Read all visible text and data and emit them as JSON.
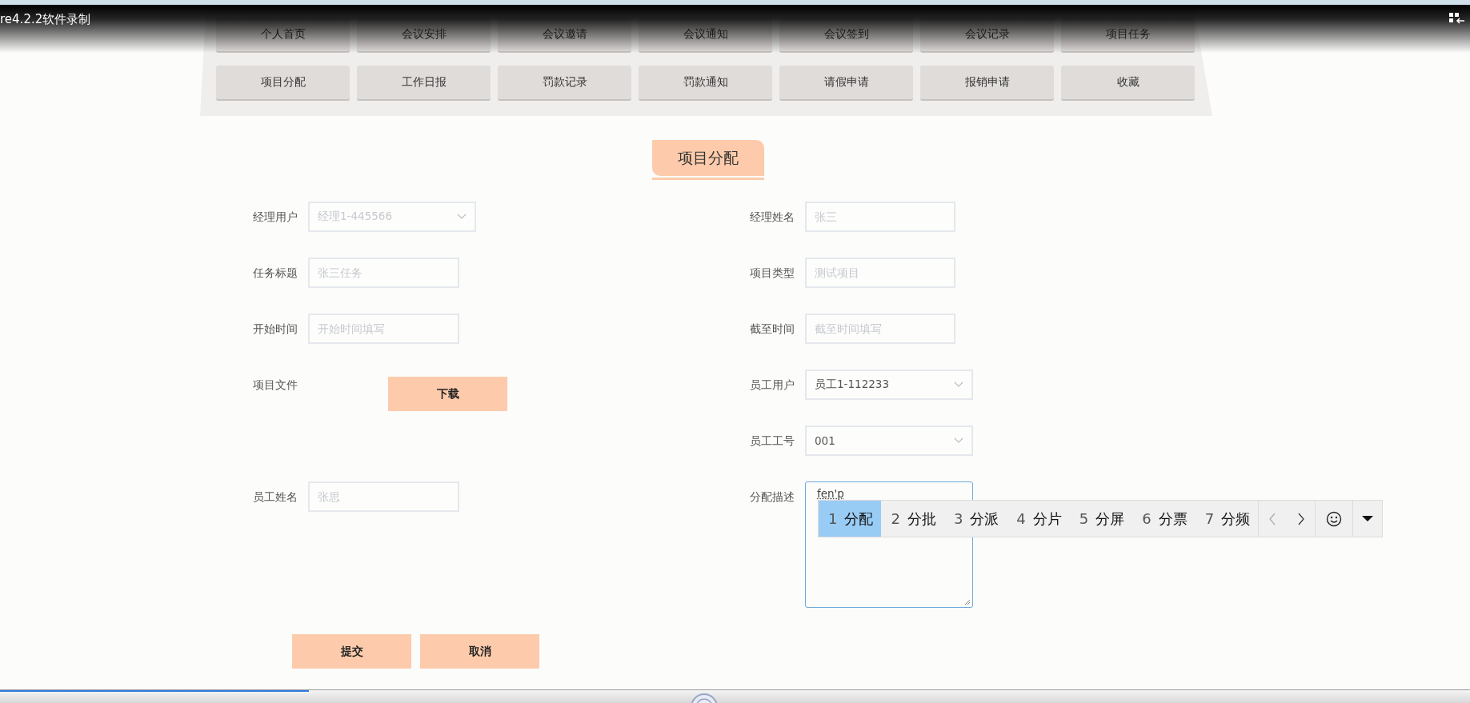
{
  "recorder_bar": {
    "title": "re4.2.2软件录制"
  },
  "nav": {
    "rows": [
      [
        {
          "label": "个人首页"
        },
        {
          "label": "会议安排"
        },
        {
          "label": "会议邀请"
        },
        {
          "label": "会议通知"
        },
        {
          "label": "会议签到"
        },
        {
          "label": "会议记录"
        },
        {
          "label": "项目任务"
        }
      ],
      [
        {
          "label": "项目分配"
        },
        {
          "label": "工作日报"
        },
        {
          "label": "罚款记录"
        },
        {
          "label": "罚款通知"
        },
        {
          "label": "请假申请"
        },
        {
          "label": "报销申请"
        },
        {
          "label": "收藏"
        }
      ]
    ]
  },
  "page_title": "项目分配",
  "form": {
    "rows": [
      {
        "left": {
          "kind": "select",
          "label": "经理用户",
          "placeholder": "经理1-445566"
        },
        "right": {
          "kind": "text",
          "label": "经理姓名",
          "placeholder": "张三"
        }
      },
      {
        "left": {
          "kind": "text",
          "label": "任务标题",
          "placeholder": "张三任务"
        },
        "right": {
          "kind": "text",
          "label": "项目类型",
          "placeholder": "测试项目"
        }
      },
      {
        "left": {
          "kind": "text",
          "label": "开始时间",
          "placeholder": "开始时间填写"
        },
        "right": {
          "kind": "text",
          "label": "截至时间",
          "placeholder": "截至时间填写"
        }
      },
      {
        "left": {
          "kind": "file",
          "label": "项目文件",
          "button": "下载"
        },
        "right": {
          "kind": "select",
          "label": "员工用户",
          "value": "员工1-112233"
        }
      },
      {
        "right": {
          "kind": "select",
          "label": "员工工号",
          "value": "001"
        }
      },
      {
        "left": {
          "kind": "text",
          "label": "员工姓名",
          "placeholder": "张思"
        },
        "right": {
          "kind": "textarea",
          "label": "分配描述",
          "value": "fen'p",
          "focused": true
        }
      }
    ],
    "buttons": [
      "提交",
      "取消"
    ]
  },
  "ime": {
    "candidates": [
      {
        "number": "1",
        "text": "分配",
        "selected": true
      },
      {
        "number": "2",
        "text": "分批",
        "selected": false
      },
      {
        "number": "3",
        "text": "分派",
        "selected": false
      },
      {
        "number": "4",
        "text": "分片",
        "selected": false
      },
      {
        "number": "5",
        "text": "分屏",
        "selected": false
      },
      {
        "number": "6",
        "text": "分票",
        "selected": false
      },
      {
        "number": "7",
        "text": "分频",
        "selected": false
      }
    ]
  },
  "recorder_progress": {
    "level": 0.21
  }
}
